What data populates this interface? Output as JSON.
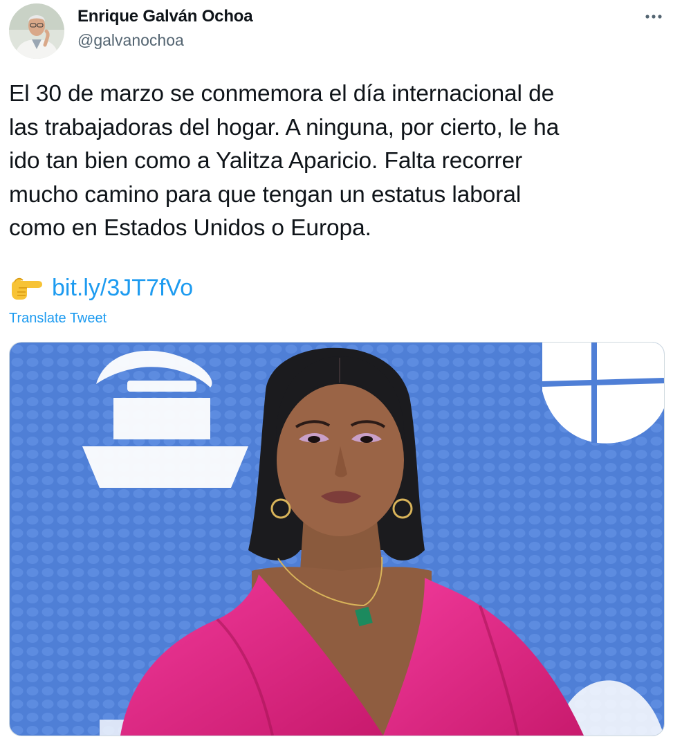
{
  "author": {
    "display_name": "Enrique Galván Ochoa",
    "handle": "@galvanochoa"
  },
  "tweet": {
    "text_lines": [
      "El 30 de marzo se conmemora el día internacional de",
      "las trabajadoras del hogar. A ninguna, por cierto, le ha",
      "ido tan bien como a Yalitza Aparicio. Falta recorrer",
      "mucho camino para que tengan un estatus laboral",
      "como en Estados Unidos o Europa."
    ],
    "link_emoji": "backhand-index-pointing-right",
    "link_text": "bit.ly/3JT7fVo",
    "translate_label": "Translate Tweet"
  },
  "colors": {
    "accent": "#1d9bf0",
    "text": "#0f1419",
    "secondary_text": "#536471",
    "image_backdrop": "#4f7fd6",
    "dress": "#e0287f"
  },
  "icons": {
    "more": "more-horizontal-icon"
  }
}
